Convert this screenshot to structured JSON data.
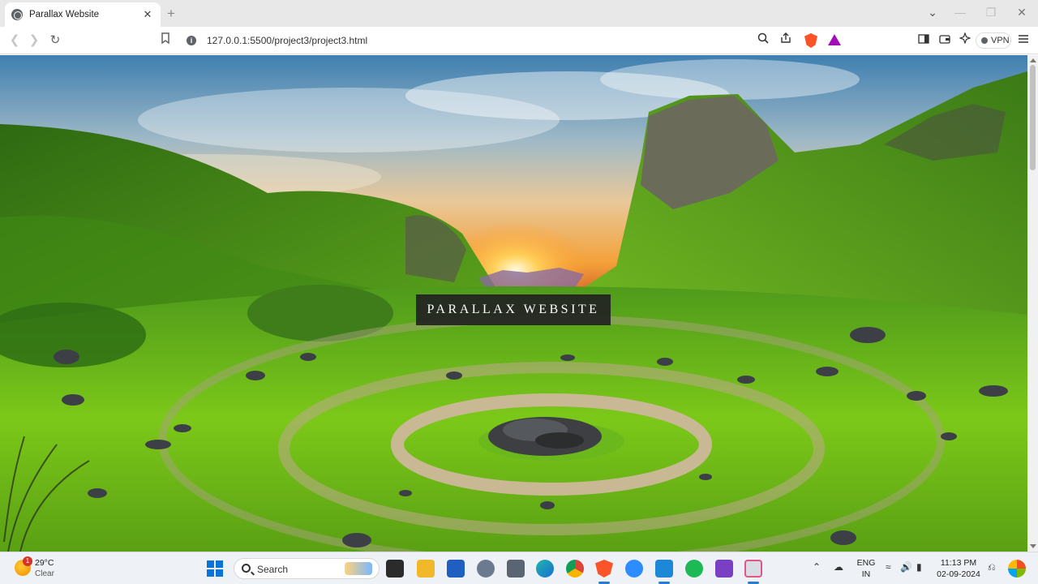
{
  "browser": {
    "tab_title": "Parallax Website",
    "tab_close": "✕",
    "new_tab": "+",
    "url": "127.0.0.1:5500/project3/project3.html",
    "info_glyph": "i",
    "vpn_label": "VPN",
    "icons": [
      "back-icon",
      "forward-icon",
      "reload-icon",
      "bookmark-icon",
      "zoom-icon",
      "share-icon",
      "brave-shield-icon",
      "brave-rewards-icon",
      "sidebar-icon",
      "wallet-icon",
      "leo-icon",
      "menu-icon"
    ]
  },
  "window": {
    "collapse_glyph": "⌄",
    "minimize_glyph": "—",
    "restore_glyph": "❐",
    "close_glyph": "✕"
  },
  "page": {
    "title": "PARALLAX WEBSITE",
    "colors": {
      "title_box": "#222222",
      "title_text": "#ffffff"
    }
  },
  "taskbar": {
    "weather": {
      "temp": "29°C",
      "condition": "Clear",
      "badge": "1"
    },
    "search_label": "Search",
    "language": {
      "line1": "ENG",
      "line2": "IN"
    },
    "time": "11:13 PM",
    "date": "02-09-2024"
  }
}
